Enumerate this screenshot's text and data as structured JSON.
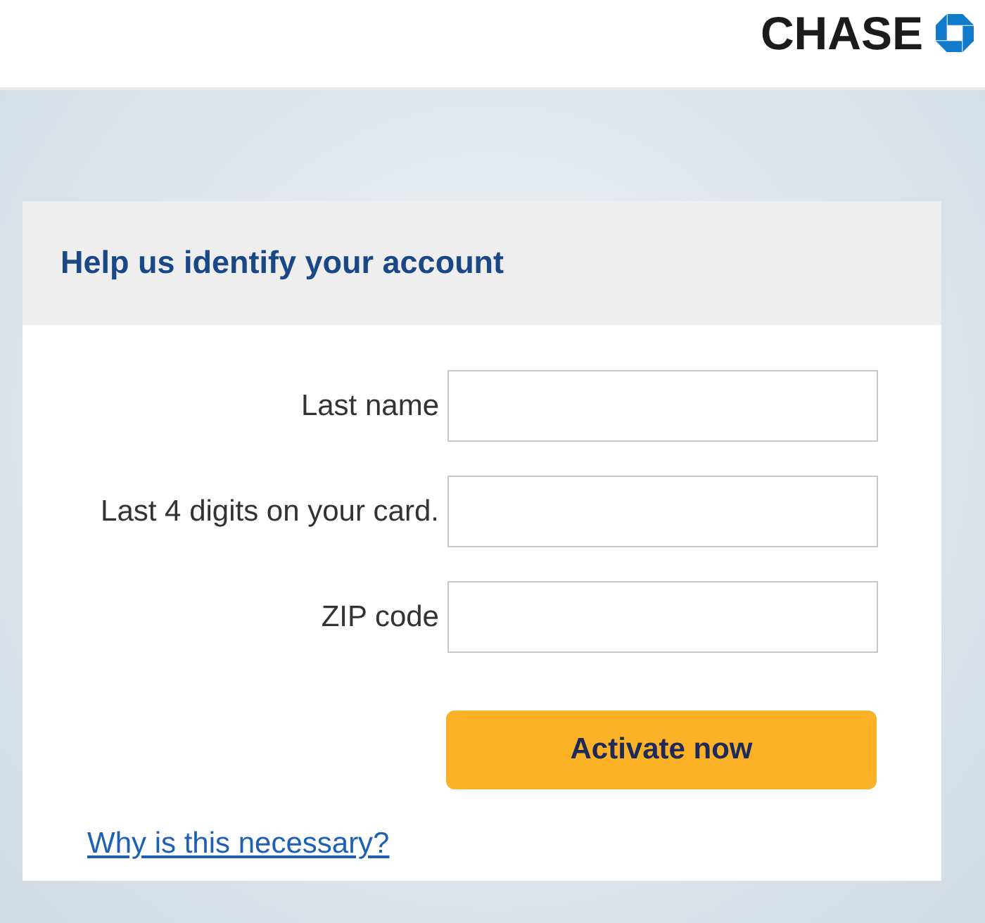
{
  "header": {
    "logo_text": "CHASE"
  },
  "card": {
    "title": "Help us identify your account",
    "fields": [
      {
        "label": "Last name"
      },
      {
        "label": "Last 4 digits on your card."
      },
      {
        "label": "ZIP code"
      }
    ],
    "button": "Activate now",
    "link": "Why is this necessary?"
  }
}
